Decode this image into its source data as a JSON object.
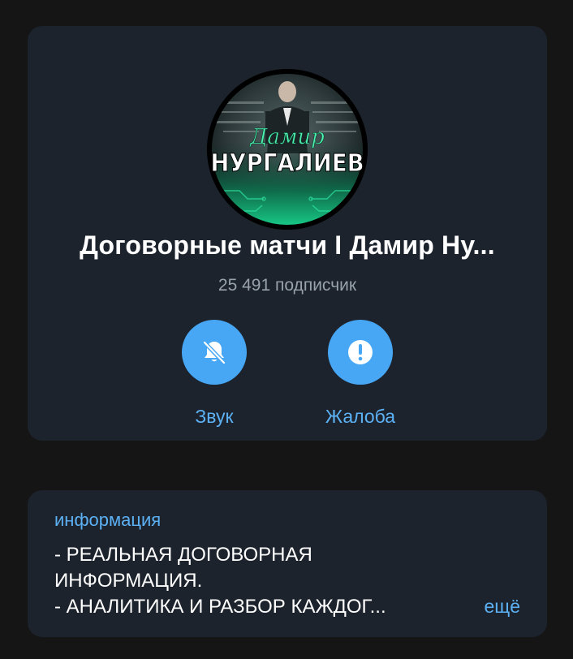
{
  "channel": {
    "title": "Договорные матчи I Дамир Ну...",
    "subscribers": "25 491 подписчик",
    "avatar": {
      "script_text": "Дамир",
      "name_text": "НУРГАЛИЕВ"
    }
  },
  "actions": [
    {
      "label": "Звук",
      "icon": "bell-off-icon"
    },
    {
      "label": "Жалоба",
      "icon": "exclamation-icon"
    }
  ],
  "info": {
    "heading": "информация",
    "lines": [
      "- РЕАЛЬНАЯ ДОГОВОРНАЯ",
      "ИНФОРМАЦИЯ.",
      "- АНАЛИТИКА И РАЗБОР КАЖДОГ..."
    ],
    "more_label": "ещё"
  },
  "colors": {
    "background": "#151515",
    "card": "#1c232d",
    "accent": "#47a7f5",
    "link": "#5cb1f4",
    "muted": "#98a2ad"
  }
}
